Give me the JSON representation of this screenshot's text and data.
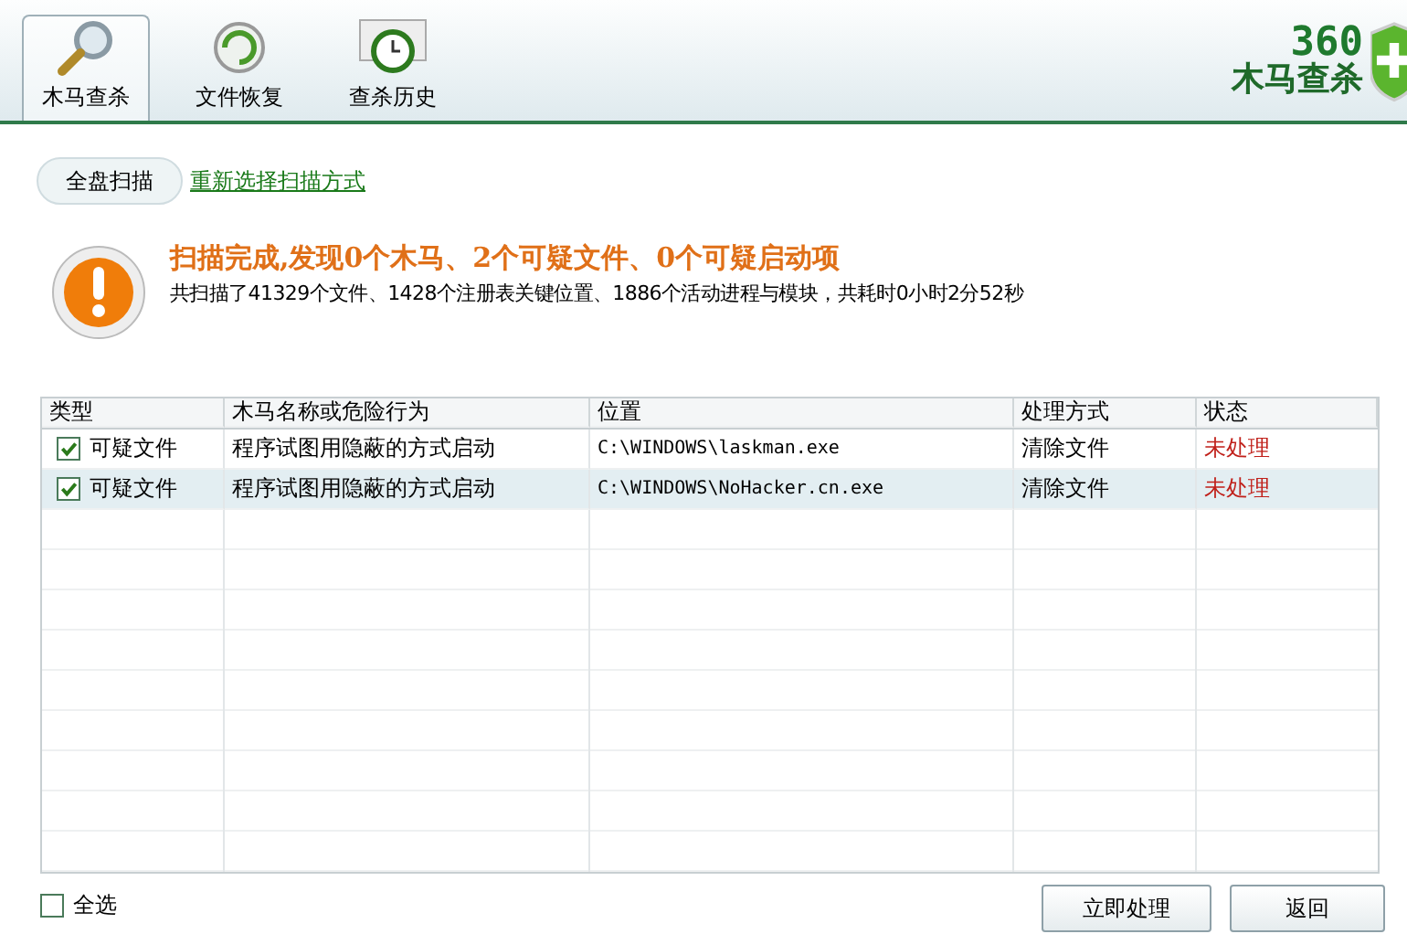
{
  "tabs": [
    {
      "label": "木马查杀",
      "selected": true,
      "kind": "scan"
    },
    {
      "label": "文件恢复",
      "selected": false,
      "kind": "restore"
    },
    {
      "label": "查杀历史",
      "selected": false,
      "kind": "history"
    }
  ],
  "logo": {
    "number": "360",
    "name": "木马查杀"
  },
  "scan_button": "全盘扫描",
  "rescan_link": "重新选择扫描方式",
  "result": {
    "title": "扫描完成,发现0个木马、2个可疑文件、0个可疑启动项",
    "summary": "共扫描了41329个文件、1428个注册表关键位置、1886个活动进程与模块，共耗时0小时2分52秒"
  },
  "table": {
    "columns": [
      "类型",
      "木马名称或危险行为",
      "位置",
      "处理方式",
      "状态"
    ],
    "rows": [
      {
        "checked": true,
        "selected": false,
        "type": "可疑文件",
        "behavior": "程序试图用隐蔽的方式启动",
        "location": "C:\\WINDOWS\\laskman.exe",
        "action": "清除文件",
        "status": "未处理"
      },
      {
        "checked": true,
        "selected": true,
        "type": "可疑文件",
        "behavior": "程序试图用隐蔽的方式启动",
        "location": "C:\\WINDOWS\\NoHacker.cn.exe",
        "action": "清除文件",
        "status": "未处理"
      }
    ]
  },
  "select_all": {
    "label": "全选",
    "checked": false
  },
  "buttons": [
    "立即处理",
    "返回"
  ]
}
